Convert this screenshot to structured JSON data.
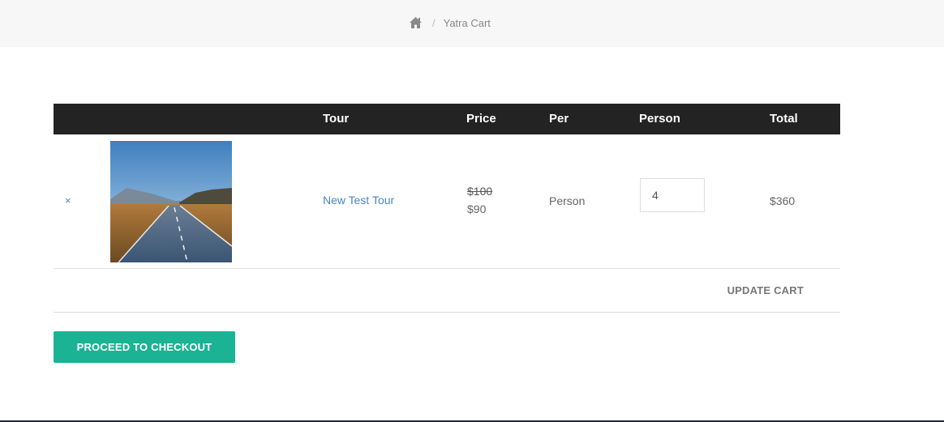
{
  "breadcrumb": {
    "home_icon": "home-icon",
    "separator": "/",
    "current": "Yatra Cart"
  },
  "table": {
    "headers": [
      "",
      "",
      "Tour",
      "Price",
      "Per",
      "Person",
      "Total"
    ],
    "rows": [
      {
        "remove_label": "×",
        "thumbnail": "road-landscape-image",
        "tour": "New Test Tour",
        "price_regular": "$100",
        "price_sale": "$90",
        "per": "Person",
        "quantity": "4",
        "total": "$360"
      }
    ]
  },
  "actions": {
    "update_cart": "UPDATE CART",
    "checkout": "PROCEED TO CHECKOUT"
  },
  "colors": {
    "header_bg": "#232323",
    "link": "#4a86c5",
    "checkout_bg": "#1ab394",
    "topbar_bg": "#f7f7f7"
  }
}
